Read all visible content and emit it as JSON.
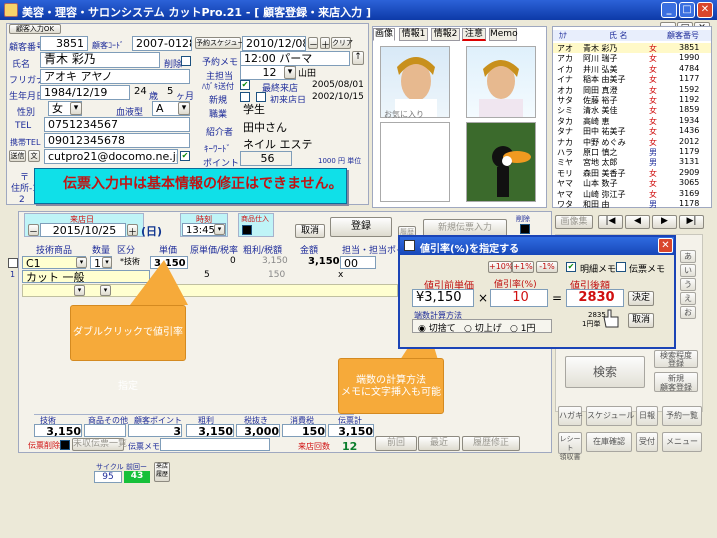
{
  "window": {
    "title": "美容・理容・サロンシステム カットPro.21 - [ 顧客登録・来店入力 ]",
    "btn_min": "_",
    "btn_max": "□",
    "btn_close": "✕"
  },
  "inner_window": {
    "btn_min": "_",
    "btn_max": "□",
    "btn_close": "✕"
  },
  "customer": {
    "badge_new": "顧客入力OK",
    "id_label": "顧客番号",
    "id": "3851",
    "code_label": "顧客ｺｰﾄﾞ",
    "code": "2007-0128",
    "delete_label": "削除",
    "name_label": "氏名",
    "name": "青木 彩乃",
    "kana_label": "フリガナ",
    "kana": "アオキ アヤノ",
    "birth_label": "生年月日",
    "birth": "1984/12/19",
    "age": "24",
    "age_unit": "歳",
    "months": "5",
    "months_unit": "ヶ月",
    "gender_label": "性別",
    "gender": "女",
    "blood_label": "血液型",
    "blood": "A",
    "tel_label": "TEL",
    "tel": "0751234567",
    "mobile_label": "携帯TEL",
    "mobile": "09012345678",
    "mailopt_label": "送信",
    "mailopt_btn": "文",
    "email": "cutpro21@docomo.ne.jp",
    "postal_label": "〒",
    "address_label": "住所-1",
    "address2_label": "2"
  },
  "schedule": {
    "label": "予約スケジュール",
    "date": "2010/12/08",
    "minus": "－",
    "plus": "＋",
    "clear": "クリア",
    "memo_label": "予約メモ",
    "memo": "12:00 パーマ",
    "stylist_label": "主担当",
    "stylist_no": "12",
    "stylist_name": "山田",
    "dm_label": "ﾊｶﾞｷ送付",
    "last_visit_label": "最終来店",
    "last_visit": "2005/08/01",
    "new_label": "新規",
    "first_visit_label": "初来店日",
    "first_visit": "2002/10/15",
    "job_label": "職業",
    "job": "学生",
    "referrer_label": "紹介者",
    "referrer": "田中さん",
    "keyword_label": "ｷｰﾜｰﾄﾞ",
    "keyword": "ネイル エステ",
    "point_label": "ポイント",
    "point": "56",
    "point_unit": "1000 円 単位"
  },
  "warning": "伝票入力中は基本情報の修正はできません。",
  "photo_tabs": [
    "画像",
    "情報1",
    "情報2",
    "注意",
    "Memo"
  ],
  "photo_caption": "お気に入り",
  "customer_list": {
    "headers": [
      "ｶﾅ",
      "氏 名",
      "顧客番号"
    ],
    "rows": [
      {
        "kana": "アオ",
        "name": "青木 彩乃",
        "sex": "女",
        "id": "3851"
      },
      {
        "kana": "アカ",
        "name": "阿川 瑞子",
        "sex": "女",
        "id": "1990"
      },
      {
        "kana": "イカ",
        "name": "井川 弘美",
        "sex": "女",
        "id": "4784"
      },
      {
        "kana": "イナ",
        "name": "稲本 由美子",
        "sex": "女",
        "id": "1177"
      },
      {
        "kana": "オカ",
        "name": "岡田 真澄",
        "sex": "女",
        "id": "1592"
      },
      {
        "kana": "サタ",
        "name": "佐藤 裕子",
        "sex": "女",
        "id": "1192"
      },
      {
        "kana": "シミ",
        "name": "清水 美佳",
        "sex": "女",
        "id": "1859"
      },
      {
        "kana": "タカ",
        "name": "高崎 恵",
        "sex": "女",
        "id": "1934"
      },
      {
        "kana": "タナ",
        "name": "田中 祐美子",
        "sex": "女",
        "id": "1436"
      },
      {
        "kana": "ナカ",
        "name": "中野 めぐみ",
        "sex": "女",
        "id": "2012"
      },
      {
        "kana": "ハラ",
        "name": "原口 慎之",
        "sex": "男",
        "id": "1179"
      },
      {
        "kana": "ミヤ",
        "name": "宮地 太郎",
        "sex": "男",
        "id": "3131"
      },
      {
        "kana": "モリ",
        "name": "森田 美香子",
        "sex": "女",
        "id": "2909"
      },
      {
        "kana": "ヤマ",
        "name": "山本 数子",
        "sex": "女",
        "id": "3065"
      },
      {
        "kana": "ヤマ",
        "name": "山崎 弥江子",
        "sex": "女",
        "id": "3169"
      },
      {
        "kana": "ワタ",
        "name": "和田 由",
        "sex": "男",
        "id": "1178"
      }
    ]
  },
  "sales": {
    "visit_label": "来店日",
    "visit_date": "2015/10/25",
    "weekday": "(日)",
    "prev": "－",
    "next": "＋",
    "time_label": "時刻",
    "time": "13:45",
    "shop_label": "商品仕入",
    "cancel_btn": "取消",
    "register_btn": "登録",
    "reprint_btn": "履歴",
    "new_slip_btn": "新規伝票入力",
    "del_label": "削除",
    "image_btn": "画像集",
    "nav_first": "|◀",
    "nav_prev": "◀",
    "nav_next": "▶",
    "nav_last": "▶|",
    "columns": [
      "技術商品",
      "数量",
      "区分",
      "単価",
      "原単価/税率",
      "粗利/税額",
      "金額",
      "担当・担当ポイ"
    ],
    "row1": {
      "item": "C1",
      "qty": "1",
      "cat": "*技術",
      "price": "3,150",
      "cost": "0",
      "gross": "3,150",
      "amount": "3,150",
      "staff": "00"
    },
    "row2": {
      "item": "カット 一般",
      "cost": "5",
      "gross": "150",
      "staff": "x"
    },
    "totals_labels": [
      "技術",
      "商品その他",
      "顧客ポイント",
      "粗利",
      "税抜き",
      "消費税",
      "伝票計"
    ],
    "totals": [
      "3,150",
      "",
      "3",
      "3,150",
      "3,000",
      "150",
      "3,150"
    ],
    "slip_delete": "伝票削除",
    "unreceived_btn": "未収伝票一覧",
    "slip_memo_label": "伝票メモ",
    "visit_count_label": "来店回数",
    "visit_count": "12",
    "prev_btn": "前回",
    "recent_btn": "最近",
    "history_btn": "履歴修正",
    "cycle_label": "サイクル",
    "previous_label": "前回ー",
    "cycle": "95",
    "previous": "43",
    "history_label": "来店\n履歴"
  },
  "dialog": {
    "title": "値引率(%)を指定する",
    "close": "✕",
    "opt_memo": "明細メモ",
    "opt_slip": "伝票メモ",
    "plus10": "+10%",
    "plus1": "+1%",
    "minus1": "-1%",
    "before_label": "値引前単価",
    "before": "¥3,150",
    "rate_label": "値引率(%)",
    "rate": "10",
    "after_label": "値引後額",
    "after": "2830",
    "decide_btn": "決定",
    "cancel_btn": "取消",
    "round_label": "端数計算方法",
    "round_opts": [
      "切捨て",
      "切上げ",
      "1円"
    ],
    "hint_value": "2835",
    "hint_unit": "1円単"
  },
  "callouts": {
    "c1": "ダブルクリックで値引率指定",
    "c2_line1": "端数の計算方法",
    "c2_line2": "メモに文字挿入も可能"
  },
  "right_buttons": {
    "search": "検索",
    "detail_search1": "検索程度",
    "detail_search2": "登録",
    "new_register1": "新規",
    "new_register2": "顧客登録",
    "kana_keys": [
      "あ",
      "い",
      "う",
      "え",
      "お"
    ],
    "row1": [
      "ハガキ",
      "スケジュール",
      "日報",
      "予約一覧"
    ],
    "row2": [
      "レシート\n領収書",
      "在庫確認",
      "受付",
      "メニュー"
    ]
  }
}
